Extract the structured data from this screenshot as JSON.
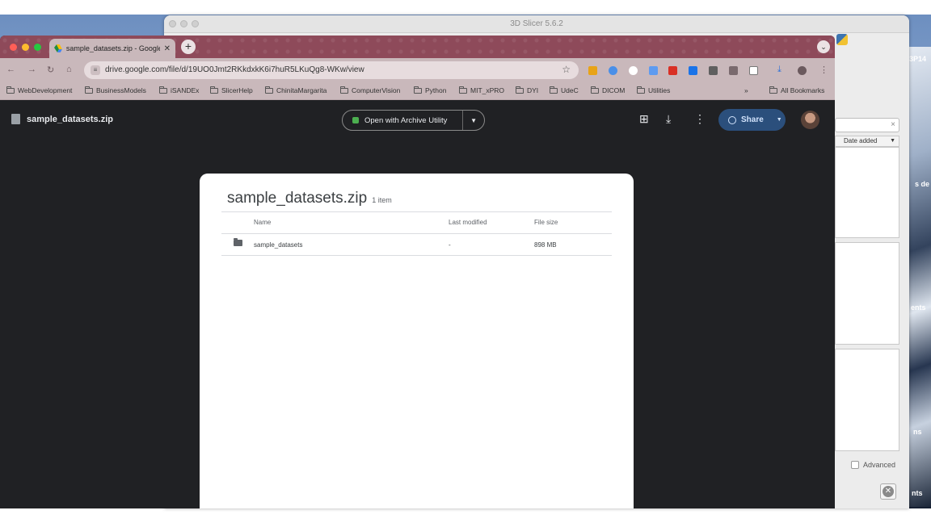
{
  "slicer": {
    "title": "3D Slicer 5.6.2",
    "sort_label": "Date added",
    "advanced_label": "Advanced"
  },
  "wallpaper_labels": [
    "3P14",
    "s de",
    "ents",
    "ns",
    "nts"
  ],
  "browser": {
    "tab_title": "sample_datasets.zip - Google",
    "url": "drive.google.com/file/d/19UO0Jmt2RKkdxkK6i7huR5LKuQg8-WKw/view",
    "bookmarks": [
      "WebDevelopment",
      "BusinessModels",
      "iSANDEx",
      "SlicerHelp",
      "ChinitaMargarita",
      "ComputerVision",
      "Python",
      "MIT_xPRO",
      "DYI",
      "UdeC",
      "DICOM",
      "Utilities"
    ],
    "bookmarks_overflow": "»",
    "all_bookmarks": "All Bookmarks"
  },
  "viewer": {
    "file_name": "sample_datasets.zip",
    "open_with": "Open with Archive Utility",
    "share": "Share"
  },
  "archive": {
    "title": "sample_datasets.zip",
    "item_count": "1 item",
    "columns": [
      "Name",
      "Last modified",
      "File size"
    ],
    "rows": [
      {
        "name": "sample_datasets",
        "modified": "-",
        "size": "898 MB"
      }
    ]
  },
  "colors": {
    "tabstrip": "#8e4a5a",
    "toolbar": "#c9b8bb",
    "viewer_bg": "#202124",
    "share_bg": "#2b4f7c"
  }
}
